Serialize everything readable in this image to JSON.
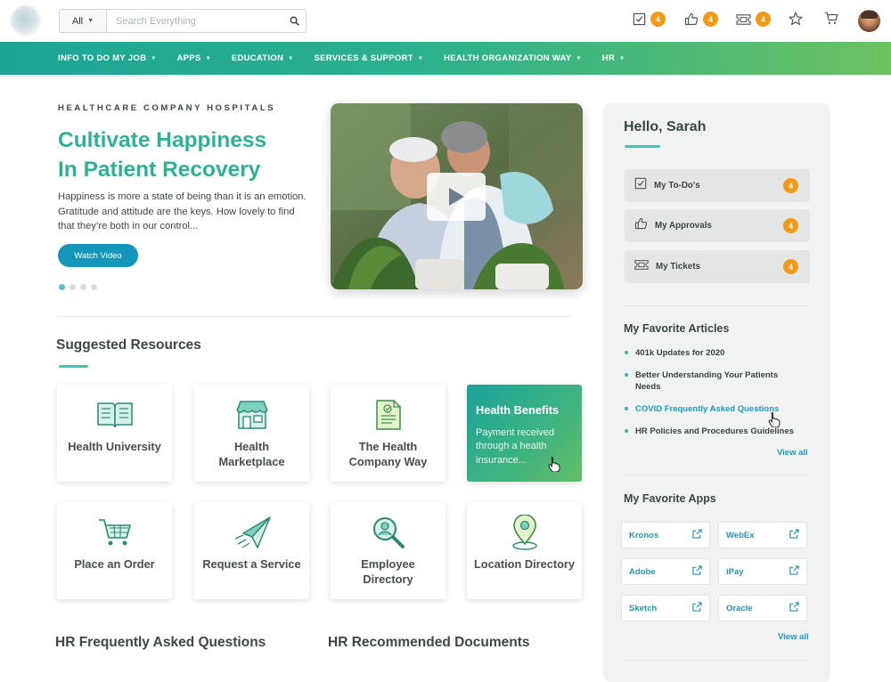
{
  "header": {
    "search_scope": "All",
    "search_placeholder": "Search Everything",
    "todo_count": "4",
    "approvals_count": "4",
    "tickets_count": "4"
  },
  "nav": {
    "items": [
      {
        "label": "INFO TO DO MY JOB"
      },
      {
        "label": "APPS"
      },
      {
        "label": "EDUCATION"
      },
      {
        "label": "SERVICES & SUPPORT"
      },
      {
        "label": "HEALTH ORGANIZATION WAY"
      },
      {
        "label": "HR"
      }
    ]
  },
  "hero": {
    "kicker": "HEALTHCARE COMPANY HOSPITALS",
    "title_line1": "Cultivate Happiness",
    "title_line2": "In Patient Recovery",
    "description": "Happiness is more a state of being than it is an emotion. Gratitude and attitude are the keys. How lovely to find that they’re both in our control...",
    "button_label": "Watch Video"
  },
  "resources": {
    "title": "Suggested Resources",
    "cards": [
      {
        "label": "Health University",
        "icon": "book-icon"
      },
      {
        "label": "Health Marketplace",
        "icon": "storefront-icon"
      },
      {
        "label": "The Health Company Way",
        "icon": "document-check-icon"
      },
      {
        "label": "Health Benefits",
        "description": "Payment received through a health insurance...",
        "featured": true
      },
      {
        "label": "Place an Order",
        "icon": "cart-icon"
      },
      {
        "label": "Request a Service",
        "icon": "paper-plane-icon"
      },
      {
        "label": "Employee Directory",
        "icon": "magnifier-person-icon"
      },
      {
        "label": "Location Directory",
        "icon": "map-pin-icon"
      }
    ]
  },
  "bottom": {
    "faq_title": "HR Frequently Asked Questions",
    "docs_title": "HR Recommended Documents"
  },
  "sidebar": {
    "greeting": "Hello, Sarah",
    "tasks": [
      {
        "label": "My To-Do's",
        "count": "4",
        "icon": "checkbox-icon"
      },
      {
        "label": "My Approvals",
        "count": "4",
        "icon": "thumbs-up-icon"
      },
      {
        "label": "My Tickets",
        "count": "4",
        "icon": "ticket-icon"
      }
    ],
    "articles_title": "My Favorite Articles",
    "articles": [
      {
        "label": "401k Updates for 2020"
      },
      {
        "label": "Better Understanding Your Patients Needs"
      },
      {
        "label": "COVID Frequently Asked Questions",
        "highlighted": true
      },
      {
        "label": "HR Policies and Procedures Guidelines"
      }
    ],
    "articles_view_all": "View all",
    "apps_title": "My Favorite Apps",
    "apps": [
      {
        "label": "Kronos"
      },
      {
        "label": "WebEx"
      },
      {
        "label": "Adobe"
      },
      {
        "label": "iPay"
      },
      {
        "label": "Sketch"
      },
      {
        "label": "Oracle"
      }
    ],
    "apps_view_all": "View all"
  },
  "colors": {
    "accent": "#2db394",
    "badge": "#f29a17",
    "link": "#1b9ac6",
    "button": "#1496bb"
  }
}
